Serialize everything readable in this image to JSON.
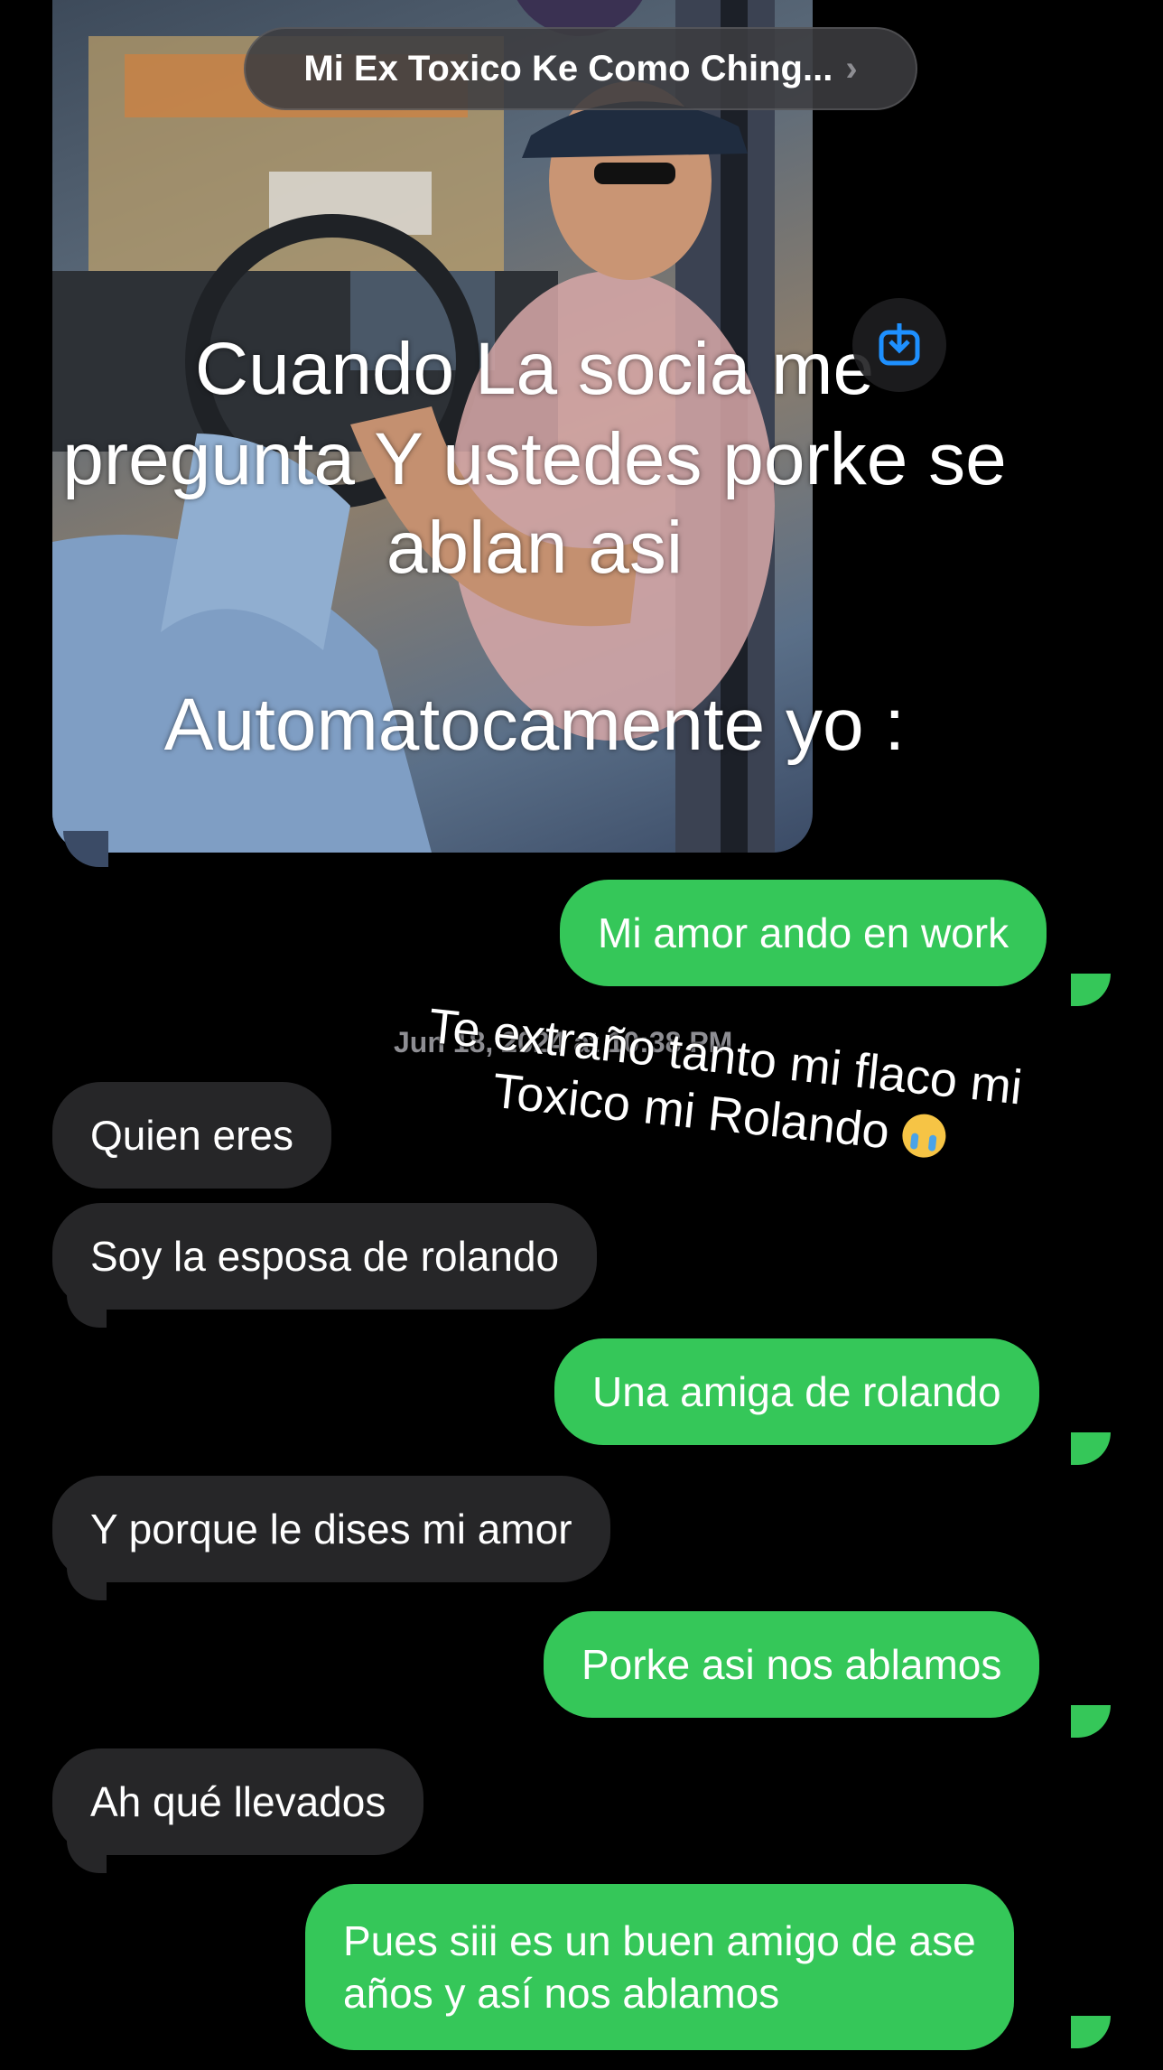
{
  "header": {
    "contact_name": "Mi Ex Toxico Ke Como Ching...",
    "chevron": "›"
  },
  "photo_message": {
    "caption_lines": [
      "Cuando La socia me",
      "pregunta Y ustedes porke se",
      "ablan asi",
      "Automatocamente yo :"
    ],
    "save_icon": "save-download-icon"
  },
  "overlay": {
    "line1": "Te extraño tanto mi flaco mi",
    "line2": "Toxico mi Rolando",
    "emoji": "loudly-crying-face"
  },
  "timestamp": "Jun 18, 2024 at 10:38 PM",
  "messages": [
    {
      "dir": "sent",
      "text": "Mi amor ando en work"
    },
    {
      "dir": "recv",
      "text": "Quien eres"
    },
    {
      "dir": "recv",
      "text": "Soy la esposa de rolando"
    },
    {
      "dir": "sent",
      "text": "Una amiga de rolando"
    },
    {
      "dir": "recv",
      "text": "Y porque le dises mi amor"
    },
    {
      "dir": "sent",
      "text": "Porke asi nos ablamos"
    },
    {
      "dir": "recv",
      "text": "Ah qué llevados"
    },
    {
      "dir": "sent",
      "text": "Pues siii es un buen amigo de ase"
    },
    {
      "dir": "sent",
      "text": "años y así nos ablamos"
    }
  ],
  "colors": {
    "sent_bubble": "#35c759",
    "recv_bubble": "#262628",
    "background": "#000000"
  }
}
